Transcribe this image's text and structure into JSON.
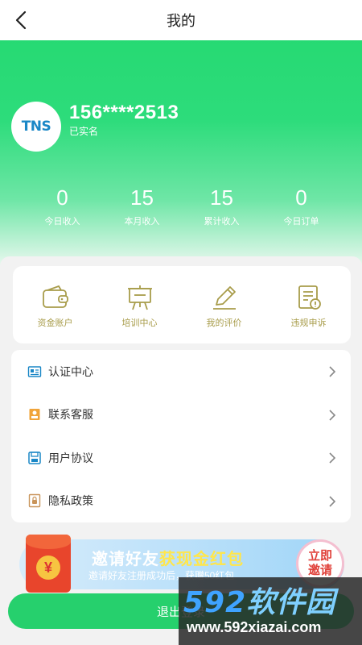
{
  "header": {
    "title": "我的"
  },
  "profile": {
    "avatar_text": "TNS",
    "phone": "156****2513",
    "verify_status": "已实名"
  },
  "stats": [
    {
      "value": "0",
      "label": "今日收入"
    },
    {
      "value": "15",
      "label": "本月收入"
    },
    {
      "value": "15",
      "label": "累计收入"
    },
    {
      "value": "0",
      "label": "今日订单"
    }
  ],
  "tools": [
    {
      "label": "资金账户",
      "icon": "wallet-icon"
    },
    {
      "label": "培训中心",
      "icon": "easel-icon"
    },
    {
      "label": "我的评价",
      "icon": "pencil-icon"
    },
    {
      "label": "违规申诉",
      "icon": "report-icon"
    }
  ],
  "menu": [
    {
      "label": "认证中心",
      "icon": "id-card-icon"
    },
    {
      "label": "联系客服",
      "icon": "service-icon"
    },
    {
      "label": "用户协议",
      "icon": "save-doc-icon"
    },
    {
      "label": "隐私政策",
      "icon": "lock-doc-icon"
    }
  ],
  "banner": {
    "title_plain": "邀请好友",
    "title_highlight": "获现金红包",
    "subtitle": "邀请好友注册成功后，获赠50红包",
    "button": "立即邀请",
    "envelope_symbol": "¥"
  },
  "logout_label": "退出登录",
  "watermark": {
    "brand": "592软件园",
    "brand_num": "592",
    "brand_cn": "软件园",
    "url": "www.592xiazai.com"
  },
  "colors": {
    "primary": "#26d06d",
    "tool_text": "#a89c4a",
    "menu_icon": "#1a87c6"
  }
}
